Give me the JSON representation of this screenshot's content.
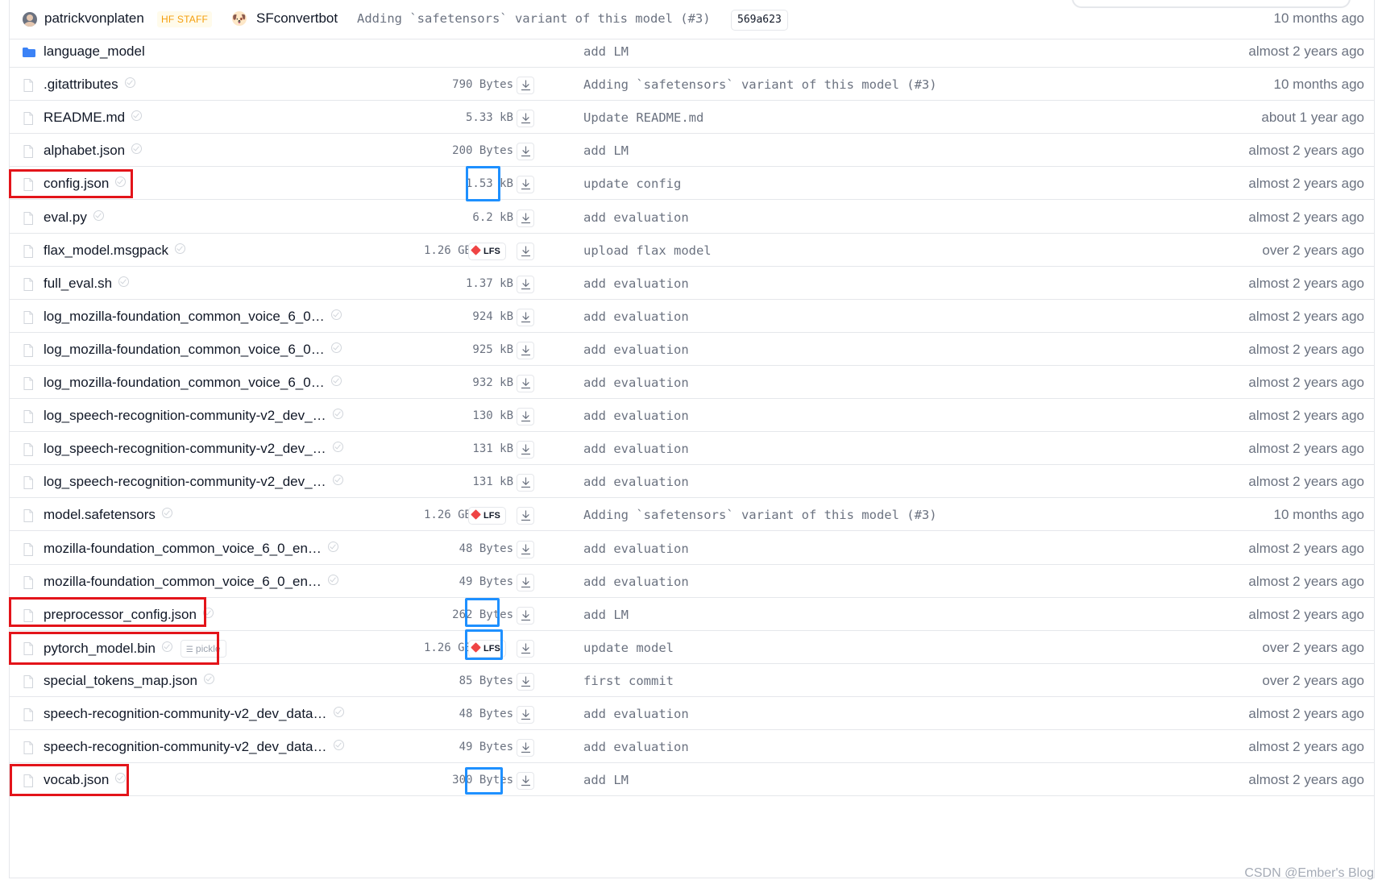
{
  "commit": {
    "author": "patrickvonplaten",
    "staff_badge": "HF STAFF",
    "bot_icon": "dog-face-icon",
    "coauthor": "SFconvertbot",
    "message": "Adding `safetensors` variant of this model (#3)",
    "hash": "569a623",
    "time": "10 months ago"
  },
  "files": [
    {
      "name": "language_model",
      "type": "folder",
      "size": "",
      "lfs": false,
      "pickle": "",
      "message": "add LM",
      "time": "almost 2 years ago"
    },
    {
      "name": ".gitattributes",
      "type": "file",
      "size": "790 Bytes",
      "lfs": false,
      "pickle": "",
      "message": "Adding `safetensors` variant of this model (#3)",
      "time": "10 months ago"
    },
    {
      "name": "README.md",
      "type": "file",
      "size": "5.33 kB",
      "lfs": false,
      "pickle": "",
      "message": "Update README.md",
      "time": "about 1 year ago"
    },
    {
      "name": "alphabet.json",
      "type": "file",
      "size": "200 Bytes",
      "lfs": false,
      "pickle": "",
      "message": "add LM",
      "time": "almost 2 years ago"
    },
    {
      "name": "config.json",
      "type": "file",
      "size": "1.53 kB",
      "lfs": false,
      "pickle": "",
      "message": "update config",
      "time": "almost 2 years ago"
    },
    {
      "name": "eval.py",
      "type": "file",
      "size": "6.2 kB",
      "lfs": false,
      "pickle": "",
      "message": "add evaluation",
      "time": "almost 2 years ago"
    },
    {
      "name": "flax_model.msgpack",
      "type": "file",
      "size": "1.26 GB",
      "lfs": true,
      "pickle": "",
      "message": "upload flax model",
      "time": "over 2 years ago"
    },
    {
      "name": "full_eval.sh",
      "type": "file",
      "size": "1.37 kB",
      "lfs": false,
      "pickle": "",
      "message": "add evaluation",
      "time": "almost 2 years ago"
    },
    {
      "name": "log_mozilla-foundation_common_voice_6_0…",
      "type": "file",
      "size": "924 kB",
      "lfs": false,
      "pickle": "",
      "message": "add evaluation",
      "time": "almost 2 years ago"
    },
    {
      "name": "log_mozilla-foundation_common_voice_6_0…",
      "type": "file",
      "size": "925 kB",
      "lfs": false,
      "pickle": "",
      "message": "add evaluation",
      "time": "almost 2 years ago"
    },
    {
      "name": "log_mozilla-foundation_common_voice_6_0…",
      "type": "file",
      "size": "932 kB",
      "lfs": false,
      "pickle": "",
      "message": "add evaluation",
      "time": "almost 2 years ago"
    },
    {
      "name": "log_speech-recognition-community-v2_dev_…",
      "type": "file",
      "size": "130 kB",
      "lfs": false,
      "pickle": "",
      "message": "add evaluation",
      "time": "almost 2 years ago"
    },
    {
      "name": "log_speech-recognition-community-v2_dev_…",
      "type": "file",
      "size": "131 kB",
      "lfs": false,
      "pickle": "",
      "message": "add evaluation",
      "time": "almost 2 years ago"
    },
    {
      "name": "log_speech-recognition-community-v2_dev_…",
      "type": "file",
      "size": "131 kB",
      "lfs": false,
      "pickle": "",
      "message": "add evaluation",
      "time": "almost 2 years ago"
    },
    {
      "name": "model.safetensors",
      "type": "file",
      "size": "1.26 GB",
      "lfs": true,
      "pickle": "",
      "message": "Adding `safetensors` variant of this model (#3)",
      "time": "10 months ago"
    },
    {
      "name": "mozilla-foundation_common_voice_6_0_en…",
      "type": "file",
      "size": "48 Bytes",
      "lfs": false,
      "pickle": "",
      "message": "add evaluation",
      "time": "almost 2 years ago"
    },
    {
      "name": "mozilla-foundation_common_voice_6_0_en…",
      "type": "file",
      "size": "49 Bytes",
      "lfs": false,
      "pickle": "",
      "message": "add evaluation",
      "time": "almost 2 years ago"
    },
    {
      "name": "preprocessor_config.json",
      "type": "file",
      "size": "262 Bytes",
      "lfs": false,
      "pickle": "",
      "message": "add LM",
      "time": "almost 2 years ago"
    },
    {
      "name": "pytorch_model.bin",
      "type": "file",
      "size": "1.26 GB",
      "lfs": true,
      "pickle": "pickle",
      "message": "update model",
      "time": "over 2 years ago"
    },
    {
      "name": "special_tokens_map.json",
      "type": "file",
      "size": "85 Bytes",
      "lfs": false,
      "pickle": "",
      "message": "first commit",
      "time": "over 2 years ago"
    },
    {
      "name": "speech-recognition-community-v2_dev_data…",
      "type": "file",
      "size": "48 Bytes",
      "lfs": false,
      "pickle": "",
      "message": "add evaluation",
      "time": "almost 2 years ago"
    },
    {
      "name": "speech-recognition-community-v2_dev_data…",
      "type": "file",
      "size": "49 Bytes",
      "lfs": false,
      "pickle": "",
      "message": "add evaluation",
      "time": "almost 2 years ago"
    },
    {
      "name": "vocab.json",
      "type": "file",
      "size": "300 Bytes",
      "lfs": false,
      "pickle": "",
      "message": "add LM",
      "time": "almost 2 years ago"
    }
  ],
  "lfs_label": "LFS",
  "highlighted_files": [
    "config.json",
    "preprocessor_config.json",
    "pytorch_model.bin",
    "vocab.json"
  ],
  "highlight_colors": {
    "filename_box": "#e3141a",
    "download_box": "#1e90ff"
  },
  "colors": {
    "lfs_icon": "#ef4444",
    "staff_badge": "#f59e0b",
    "folder_icon": "#3b82f6"
  },
  "watermark": "CSDN @Ember's Blog"
}
